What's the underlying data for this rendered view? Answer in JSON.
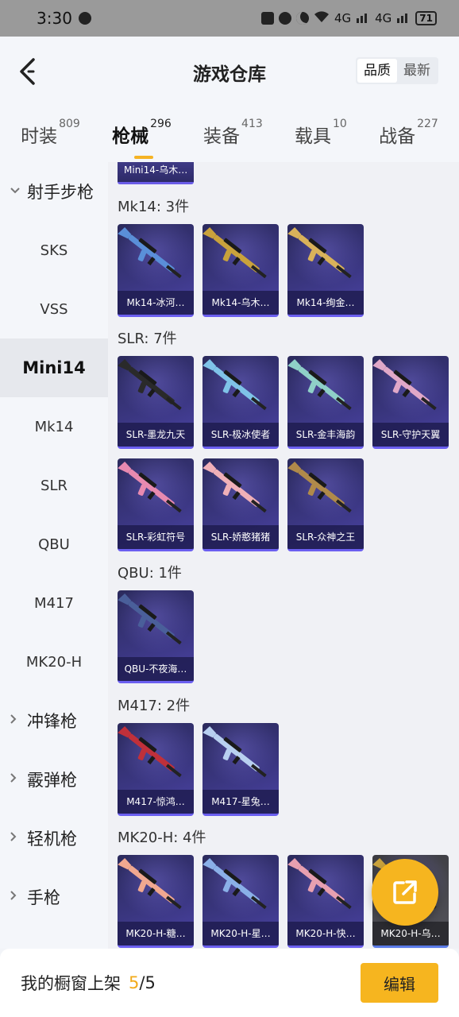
{
  "status_bar": {
    "time": "3:30",
    "battery": "71",
    "network_a": "4G",
    "network_b": "4G"
  },
  "header": {
    "title": "游戏仓库",
    "sort_options": [
      "品质",
      "最新"
    ],
    "sort_active": "品质"
  },
  "tabs": [
    {
      "label": "时装",
      "count": "809",
      "active": false
    },
    {
      "label": "枪械",
      "count": "296",
      "active": true
    },
    {
      "label": "装备",
      "count": "413",
      "active": false
    },
    {
      "label": "载具",
      "count": "10",
      "active": false
    },
    {
      "label": "战备",
      "count": "227",
      "active": false
    }
  ],
  "sidebar": [
    {
      "label": "射手步枪",
      "type": "category",
      "expanded": true
    },
    {
      "label": "SKS",
      "type": "sub"
    },
    {
      "label": "VSS",
      "type": "sub"
    },
    {
      "label": "Mini14",
      "type": "sub",
      "selected": true
    },
    {
      "label": "Mk14",
      "type": "sub"
    },
    {
      "label": "SLR",
      "type": "sub"
    },
    {
      "label": "QBU",
      "type": "sub"
    },
    {
      "label": "M417",
      "type": "sub"
    },
    {
      "label": "MK20-H",
      "type": "sub"
    },
    {
      "label": "冲锋枪",
      "type": "category",
      "expanded": false
    },
    {
      "label": "霰弹枪",
      "type": "category",
      "expanded": false
    },
    {
      "label": "轻机枪",
      "type": "category",
      "expanded": false
    },
    {
      "label": "手枪",
      "type": "category",
      "expanded": false
    }
  ],
  "partial_item": "Mini14-乌木…",
  "sections": [
    {
      "title": "Mk14: 3件",
      "items": [
        {
          "name": "Mk14-冰河…",
          "color": "#5a8fd8"
        },
        {
          "name": "Mk14-乌木…",
          "color": "#c9a23c"
        },
        {
          "name": "Mk14-绚金…",
          "color": "#d9b25a"
        }
      ]
    },
    {
      "title": "SLR: 7件",
      "items": [
        {
          "name": "SLR-墨龙九天",
          "color": "#2a2a2a"
        },
        {
          "name": "SLR-极冰使者",
          "color": "#7fc3e8"
        },
        {
          "name": "SLR-金丰海韵",
          "color": "#8fd0c8"
        },
        {
          "name": "SLR-守护天翼",
          "color": "#e0a8c8"
        },
        {
          "name": "SLR-彩虹符号",
          "color": "#e88ab0"
        },
        {
          "name": "SLR-娇憨猪猪",
          "color": "#f0b0b8"
        },
        {
          "name": "SLR-众神之王",
          "color": "#b08a4a"
        }
      ]
    },
    {
      "title": "QBU: 1件",
      "items": [
        {
          "name": "QBU-不夜海…",
          "color": "#4a5f9a"
        }
      ]
    },
    {
      "title": "M417: 2件",
      "items": [
        {
          "name": "M417-惊鸿…",
          "color": "#c0303a"
        },
        {
          "name": "M417-星兔…",
          "color": "#b8d0f0"
        }
      ]
    },
    {
      "title": "MK20-H: 4件",
      "items": [
        {
          "name": "MK20-H-糖…",
          "color": "#f0a890"
        },
        {
          "name": "MK20-H-星…",
          "color": "#8ab0e8"
        },
        {
          "name": "MK20-H-快…",
          "color": "#e8a0b0"
        },
        {
          "name": "MK20-H-乌…",
          "color": "#c9a23c",
          "gray": true
        }
      ]
    }
  ],
  "bottom_bar": {
    "text": "我的橱窗上架",
    "count": "5",
    "total": "/5",
    "edit_label": "编辑"
  },
  "accent_color": "#f6b51f"
}
